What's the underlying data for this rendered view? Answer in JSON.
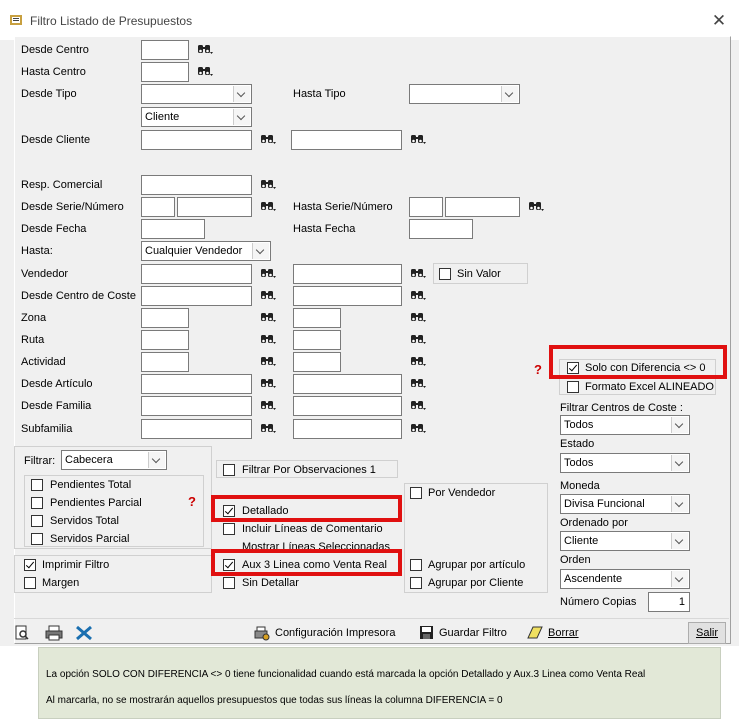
{
  "window": {
    "title": "Filtro Listado de Presupuestos",
    "close": "✕"
  },
  "labels": {
    "desde_centro": "Desde Centro",
    "hasta_centro": "Hasta Centro",
    "desde_tipo": "Desde Tipo",
    "hasta_tipo": "Hasta Tipo",
    "desde_cliente": "Desde Cliente",
    "resp_comercial": "Resp. Comercial",
    "desde_serie": "Desde Serie/Número",
    "hasta_serie": "Hasta Serie/Número",
    "desde_fecha": "Desde Fecha",
    "hasta_fecha": "Hasta Fecha",
    "hasta": "Hasta:",
    "vendedor": "Vendedor",
    "desde_centro_coste": "Desde Centro de Coste",
    "zona": "Zona",
    "ruta": "Ruta",
    "actividad": "Actividad",
    "desde_articulo": "Desde Artículo",
    "desde_familia": "Desde Familia",
    "subfamilia": "Subfamilia",
    "filtrar": "Filtrar:",
    "filtrar_centros": "Filtrar Centros de Coste :",
    "estado": "Estado",
    "moneda": "Moneda",
    "ordenado_por": "Ordenado por",
    "orden": "Orden",
    "numero_copias": "Número Copias"
  },
  "values": {
    "desde_tipo_2": "Cliente",
    "hasta": "Cualquier Vendedor",
    "filtrar": "Cabecera",
    "filtrar_centros": "Todos",
    "estado": "Todos",
    "moneda": "Divisa Funcional",
    "ordenado_por": "Cliente",
    "orden": "Ascendente",
    "numero_copias": "1"
  },
  "checkboxes": {
    "sin_valor": "Sin Valor",
    "solo_diferencia": "Solo con Diferencia <> 0",
    "formato_excel": "Formato Excel ALINEADO",
    "pendientes_total": "Pendientes Total",
    "pendientes_parcial": "Pendientes Parcial",
    "servidos_total": "Servidos Total",
    "servidos_parcial": "Servidos Parcial",
    "filtrar_observaciones": "Filtrar Por Observaciones 1",
    "por_vendedor": "Por Vendedor",
    "detallado": "Detallado",
    "incluir_comentario": "Incluir Líneas de Comentario",
    "mostrar_lineas": "Mostrar Líneas Seleccionadas",
    "imprimir_filtro": "Imprimir Filtro",
    "margen": "Margen",
    "aux3": "Aux 3  Linea como Venta Real",
    "sin_detallar": "Sin Detallar",
    "agrupar_articulo": "Agrupar por artículo",
    "agrupar_cliente": "Agrupar por Cliente"
  },
  "toolbar": {
    "config": "Configuración Impresora",
    "guardar": "Guardar Filtro",
    "borrar": "Borrar",
    "salir": "Salir"
  },
  "note": {
    "line1": "La opción SOLO CON DIFERENCIA <> 0 tiene funcionalidad cuando está marcada la opción Detallado y Aux.3 Linea como Venta Real",
    "line2": "Al marcarla, no se mostrarán aquellos presupuestos que todas sus líneas la columna DIFERENCIA = 0"
  },
  "icons": {
    "search": "binoculars-icon",
    "help": "question-icon"
  },
  "colors": {
    "highlight": "#e01010",
    "note_bg": "#e2e8d7"
  }
}
